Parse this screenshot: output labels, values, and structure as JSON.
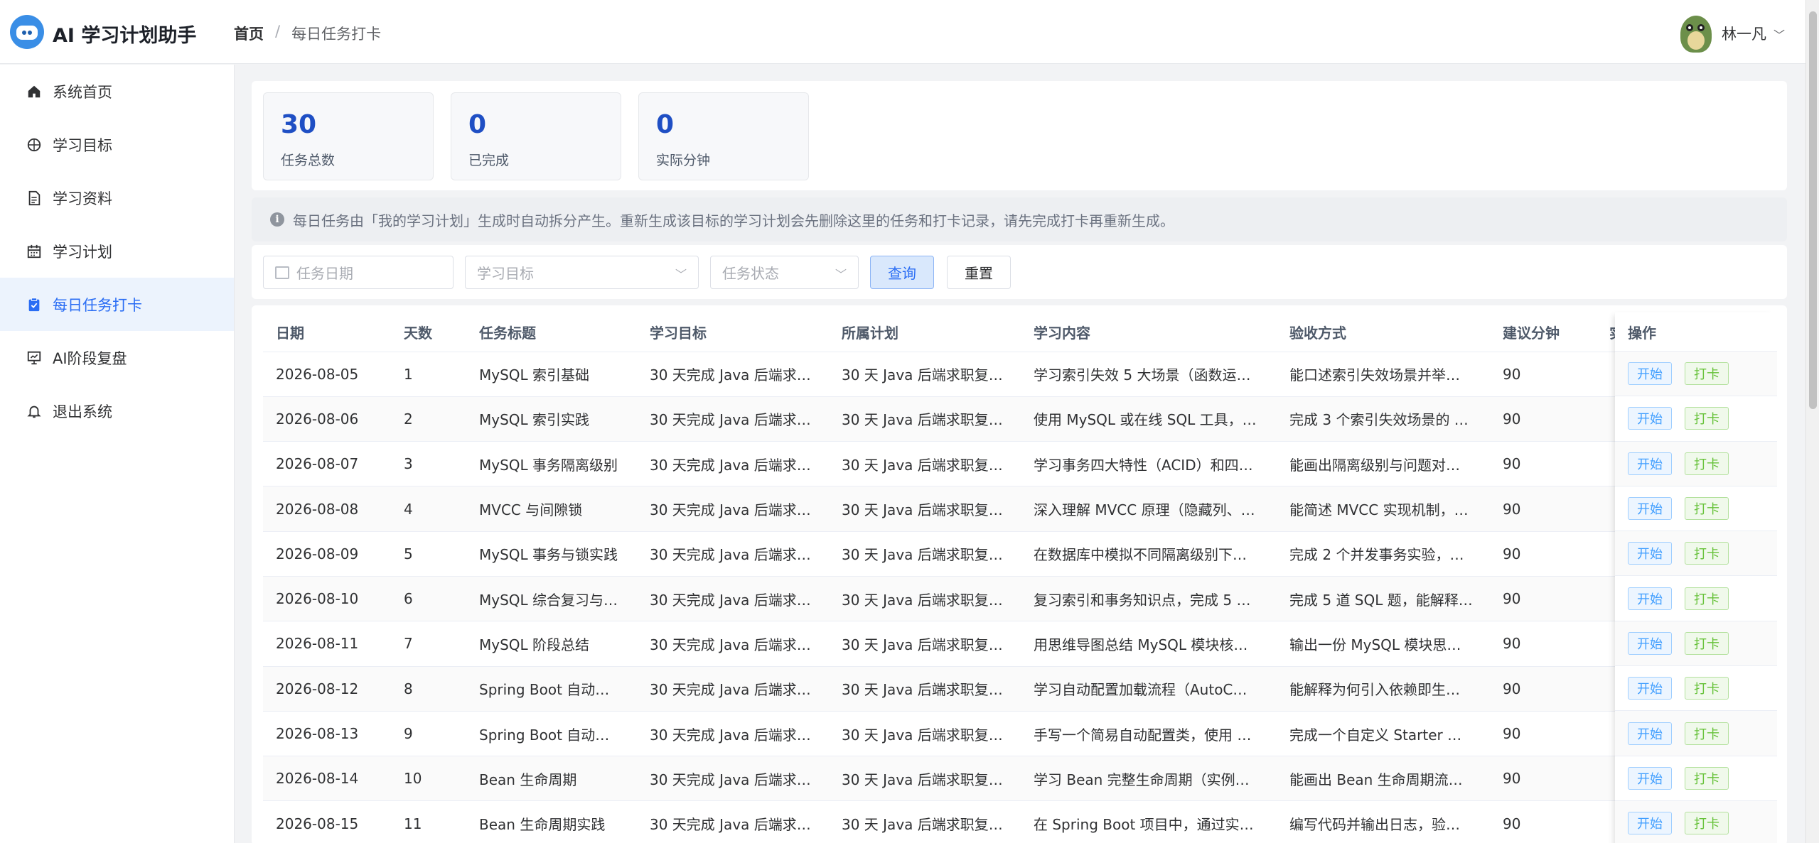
{
  "app": {
    "title": "AI 学习计划助手"
  },
  "breadcrumb": {
    "home": "首页",
    "sep": "/",
    "current": "每日任务打卡"
  },
  "user": {
    "name": "林一凡",
    "chevron": "﹀"
  },
  "sidebar": {
    "items": [
      {
        "label": "系统首页",
        "icon": "home-icon"
      },
      {
        "label": "学习目标",
        "icon": "target-icon"
      },
      {
        "label": "学习资料",
        "icon": "document-icon"
      },
      {
        "label": "学习计划",
        "icon": "calendar-icon"
      },
      {
        "label": "每日任务打卡",
        "icon": "checklist-icon",
        "active": true
      },
      {
        "label": "AI阶段复盘",
        "icon": "chart-board-icon"
      },
      {
        "label": "退出系统",
        "icon": "bell-icon"
      }
    ]
  },
  "stats": [
    {
      "value": "30",
      "label": "任务总数"
    },
    {
      "value": "0",
      "label": "已完成"
    },
    {
      "value": "0",
      "label": "实际分钟"
    }
  ],
  "notice": {
    "icon": "info-icon",
    "text": "每日任务由「我的学习计划」生成时自动拆分产生。重新生成该目标的学习计划会先删除这里的任务和打卡记录，请先完成打卡再重新生成。"
  },
  "filters": {
    "date_placeholder": "任务日期",
    "goal_placeholder": "学习目标",
    "status_placeholder": "任务状态",
    "query": "查询",
    "reset": "重置"
  },
  "table": {
    "headers": [
      "日期",
      "天数",
      "任务标题",
      "学习目标",
      "所属计划",
      "学习内容",
      "验收方式",
      "建议分钟",
      "实"
    ],
    "op_header": "操作",
    "start_label": "开始",
    "checkin_label": "打卡",
    "rows": [
      [
        "2026-08-05",
        "1",
        "MySQL 索引基础",
        "30 天完成 Java 后端求…",
        "30 天 Java 后端求职复…",
        "学习索引失效 5 大场景（函数运…",
        "能口述索引失效场景并举…",
        "90"
      ],
      [
        "2026-08-06",
        "2",
        "MySQL 索引实践",
        "30 天完成 Java 后端求…",
        "30 天 Java 后端求职复…",
        "使用 MySQL 或在线 SQL 工具，…",
        "完成 3 个索引失效场景的 …",
        "90"
      ],
      [
        "2026-08-07",
        "3",
        "MySQL 事务隔离级别",
        "30 天完成 Java 后端求…",
        "30 天 Java 后端求职复…",
        "学习事务四大特性（ACID）和四…",
        "能画出隔离级别与问题对…",
        "90"
      ],
      [
        "2026-08-08",
        "4",
        "MVCC 与间隙锁",
        "30 天完成 Java 后端求…",
        "30 天 Java 后端求职复…",
        "深入理解 MVCC 原理（隐藏列、…",
        "能简述 MVCC 实现机制，…",
        "90"
      ],
      [
        "2026-08-09",
        "5",
        "MySQL 事务与锁实践",
        "30 天完成 Java 后端求…",
        "30 天 Java 后端求职复…",
        "在数据库中模拟不同隔离级别下…",
        "完成 2 个并发事务实验，…",
        "90"
      ],
      [
        "2026-08-10",
        "6",
        "MySQL 综合复习与…",
        "30 天完成 Java 后端求…",
        "30 天 Java 后端求职复…",
        "复习索引和事务知识点，完成 5 …",
        "完成 5 道 SQL 题，能解释…",
        "90"
      ],
      [
        "2026-08-11",
        "7",
        "MySQL 阶段总结",
        "30 天完成 Java 后端求…",
        "30 天 Java 后端求职复…",
        "用思维导图总结 MySQL 模块核…",
        "输出一份 MySQL 模块思…",
        "90"
      ],
      [
        "2026-08-12",
        "8",
        "Spring Boot 自动…",
        "30 天完成 Java 后端求…",
        "30 天 Java 后端求职复…",
        "学习自动配置加载流程（AutoC…",
        "能解释为何引入依赖即生…",
        "90"
      ],
      [
        "2026-08-13",
        "9",
        "Spring Boot 自动…",
        "30 天完成 Java 后端求…",
        "30 天 Java 后端求职复…",
        "手写一个简易自动配置类，使用 …",
        "完成一个自定义 Starter …",
        "90"
      ],
      [
        "2026-08-14",
        "10",
        "Bean 生命周期",
        "30 天完成 Java 后端求…",
        "30 天 Java 后端求职复…",
        "学习 Bean 完整生命周期（实例…",
        "能画出 Bean 生命周期流…",
        "90"
      ],
      [
        "2026-08-15",
        "11",
        "Bean 生命周期实践",
        "30 天完成 Java 后端求…",
        "30 天 Java 后端求职复…",
        "在 Spring Boot 项目中，通过实…",
        "编写代码并输出日志，验…",
        "90"
      ]
    ]
  }
}
